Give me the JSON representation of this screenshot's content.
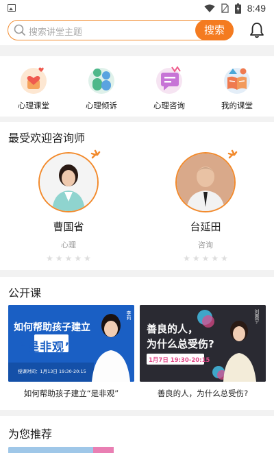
{
  "status_bar": {
    "time": "8:49"
  },
  "search": {
    "placeholder": "搜索讲堂主题",
    "button": "搜索"
  },
  "categories": [
    {
      "label": "心理课堂",
      "icon": "heart-classroom-icon"
    },
    {
      "label": "心理倾诉",
      "icon": "people-talk-icon"
    },
    {
      "label": "心理咨询",
      "icon": "chat-bubble-icon"
    },
    {
      "label": "我的课堂",
      "icon": "open-book-icon"
    }
  ],
  "counselors": {
    "title": "最受欢迎咨询师",
    "items": [
      {
        "name": "曹国省",
        "tag": "心理",
        "rating": 0
      },
      {
        "name": "台延田",
        "tag": "咨询",
        "rating": 0
      }
    ]
  },
  "open_course": {
    "title": "公开课",
    "items": [
      {
        "caption": "如何帮助孩子建立“是非观”",
        "thumb": {
          "line1": "如何帮助孩子建立",
          "line2": "“是非观”",
          "time": "授课时间：1月13日 19:30-20:15",
          "teacher": "李莉"
        }
      },
      {
        "caption": "善良的人，为什么总受伤?",
        "thumb": {
          "line1": "善良的人，",
          "line2": "为什么总受伤?",
          "time": "1月7日  19:30-20:15",
          "teacher": "刘惠宁"
        }
      }
    ]
  },
  "recommend": {
    "title": "为您推荐"
  },
  "colors": {
    "accent": "#f47b20",
    "border": "#f28a2c",
    "background": "#f2f2f2"
  }
}
